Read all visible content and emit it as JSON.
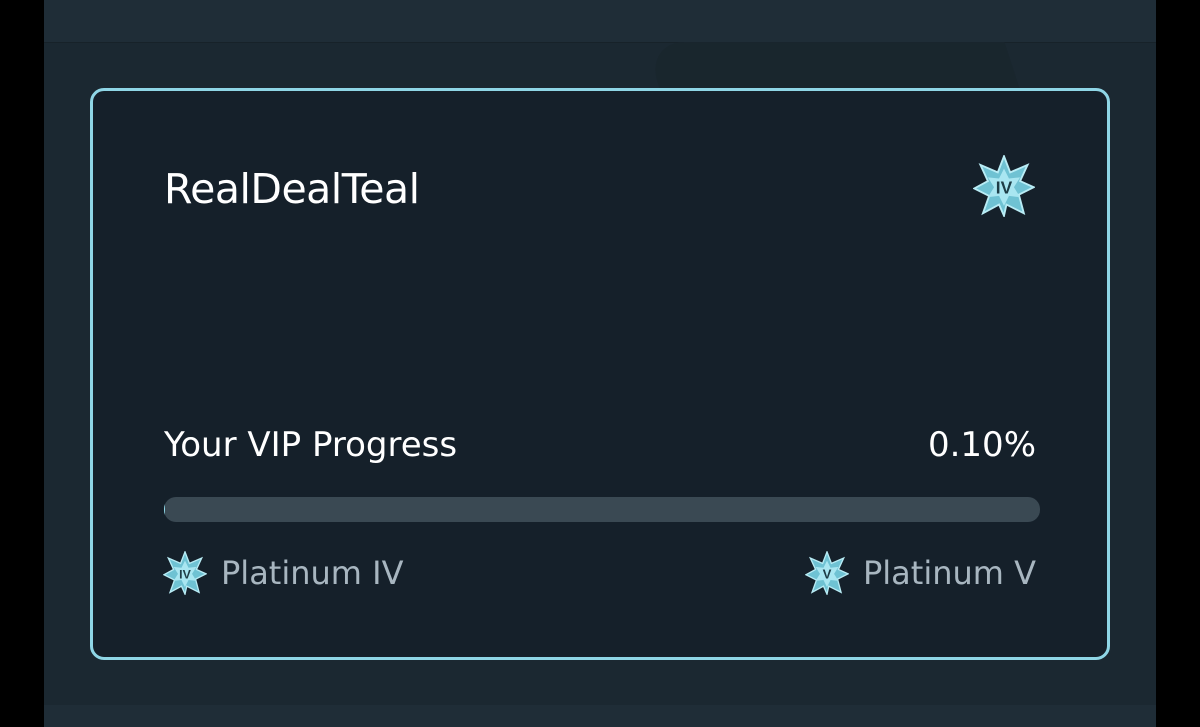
{
  "profile": {
    "username": "RealDealTeal",
    "current_tier_badge": "IV"
  },
  "vip_progress": {
    "title": "Your VIP Progress",
    "percent_text": "0.10%",
    "percent_value": 0.1
  },
  "tiers": {
    "current": {
      "badge": "IV",
      "label": "Platinum IV",
      "icon": "platinum-star-icon"
    },
    "next": {
      "badge": "V",
      "label": "Platinum V",
      "icon": "platinum-star-icon"
    }
  },
  "colors": {
    "accent": "#8fd6e6",
    "card_bg": "#15202a",
    "track": "#3a4953",
    "muted_text": "#a8b6c0"
  }
}
